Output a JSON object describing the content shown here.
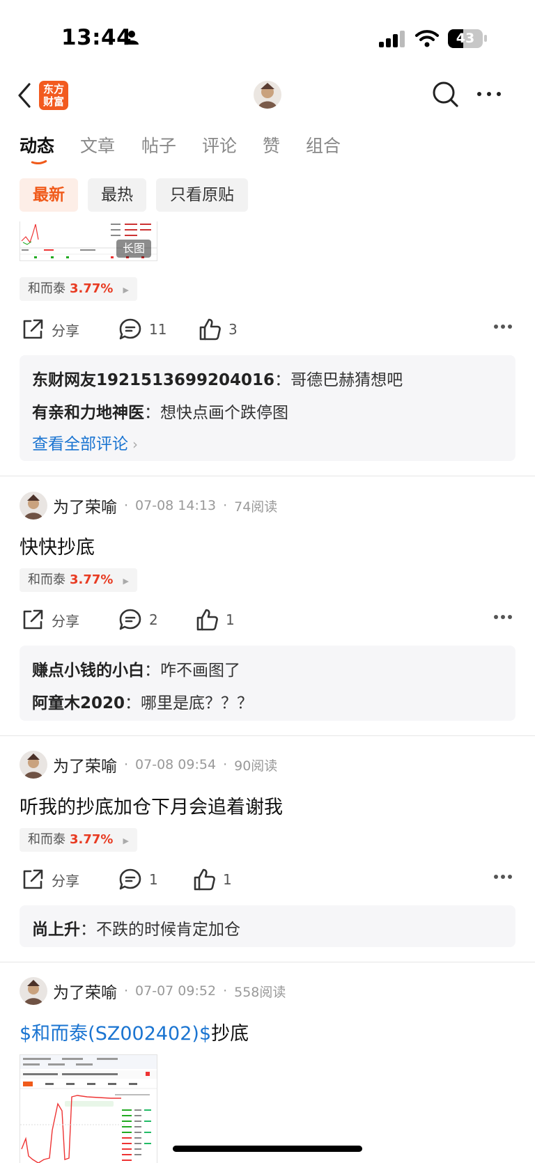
{
  "status_bar": {
    "time": "13:44",
    "battery": "43"
  },
  "nav": {
    "logo_line1": "东方",
    "logo_line2": "财富"
  },
  "tabs": [
    {
      "label": "动态",
      "active": true
    },
    {
      "label": "文章"
    },
    {
      "label": "帖子"
    },
    {
      "label": "评论"
    },
    {
      "label": "赞"
    },
    {
      "label": "组合"
    }
  ],
  "filters": [
    {
      "label": "最新",
      "active": true
    },
    {
      "label": "最热"
    },
    {
      "label": "只看原贴"
    }
  ],
  "posts": [
    {
      "image_badge": "长图",
      "stock": {
        "name": "和而泰",
        "change": "3.77%"
      },
      "actions": {
        "share": "分享",
        "comments": "11",
        "likes": "3"
      },
      "comments": [
        {
          "user": "东财网友1921513699204016",
          "sep": "：",
          "text": "哥德巴赫猜想吧"
        },
        {
          "user": "有亲和力地神医",
          "sep": "：",
          "text": "想快点画个跌停图"
        }
      ],
      "view_all": "查看全部评论"
    },
    {
      "author": "为了荣喻",
      "time": "07-08 14:13",
      "reads": "74阅读",
      "text": "快快抄底",
      "stock": {
        "name": "和而泰",
        "change": "3.77%"
      },
      "actions": {
        "share": "分享",
        "comments": "2",
        "likes": "1"
      },
      "comments": [
        {
          "user": "赚点小钱的小白",
          "sep": "：",
          "text": "咋不画图了"
        },
        {
          "user": "阿童木2020",
          "sep": "：",
          "text": "哪里是底？？？"
        }
      ]
    },
    {
      "author": "为了荣喻",
      "time": "07-08 09:54",
      "reads": "90阅读",
      "text": "听我的抄底加仓下月会追着谢我",
      "stock": {
        "name": "和而泰",
        "change": "3.77%"
      },
      "actions": {
        "share": "分享",
        "comments": "1",
        "likes": "1"
      },
      "comments": [
        {
          "user": "尚上升",
          "sep": "：",
          "text": "不跌的时候肯定加仓"
        }
      ]
    },
    {
      "author": "为了荣喻",
      "time": "07-07 09:52",
      "reads": "558阅读",
      "text_link": "$和而泰(SZ002402)$",
      "text": "抄底"
    }
  ]
}
